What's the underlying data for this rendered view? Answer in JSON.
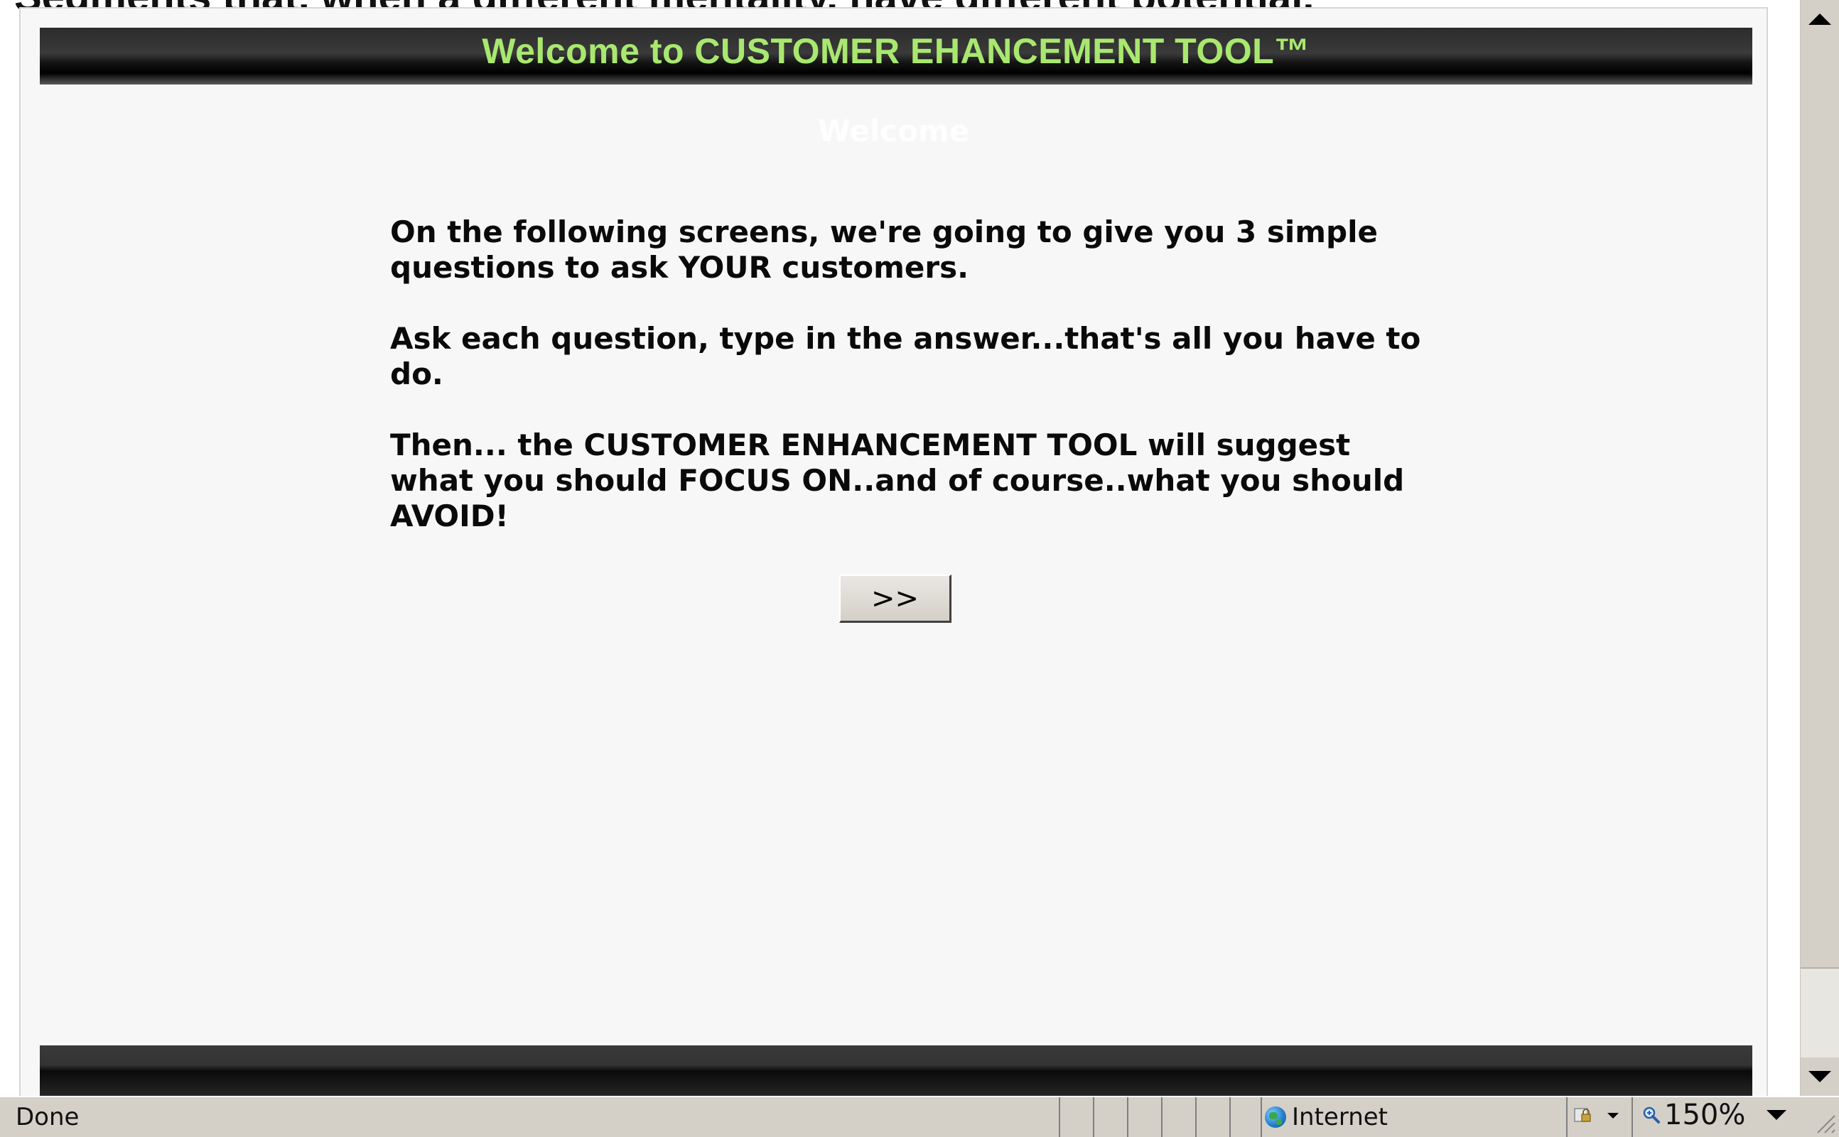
{
  "page": {
    "clipped_top_text": "Segments that, when a different mentality, have different potential.",
    "header_title": "Welcome to CUSTOMER EHANCEMENT TOOL™",
    "subtitle": "Welcome",
    "paragraphs": [
      "On the following screens, we're going to give you 3 simple questions to ask YOUR customers.",
      "Ask each question, type in the answer...that's all you have to do.",
      "Then... the CUSTOMER ENHANCEMENT TOOL will suggest what you should FOCUS ON..and of course..what you should AVOID!"
    ],
    "next_button_label": ">>"
  },
  "statusbar": {
    "status_text": "Done",
    "zone_label": "Internet",
    "zoom_value": "150%",
    "icons": {
      "zone": "globe-icon",
      "protected_mode": "lock-icon",
      "zoom": "magnifier-icon"
    }
  },
  "colors": {
    "header_text": "#a9e86f",
    "header_bar": "#1a1a1a",
    "page_background": "#f7f7f7",
    "chrome": "#d4d0c8"
  }
}
